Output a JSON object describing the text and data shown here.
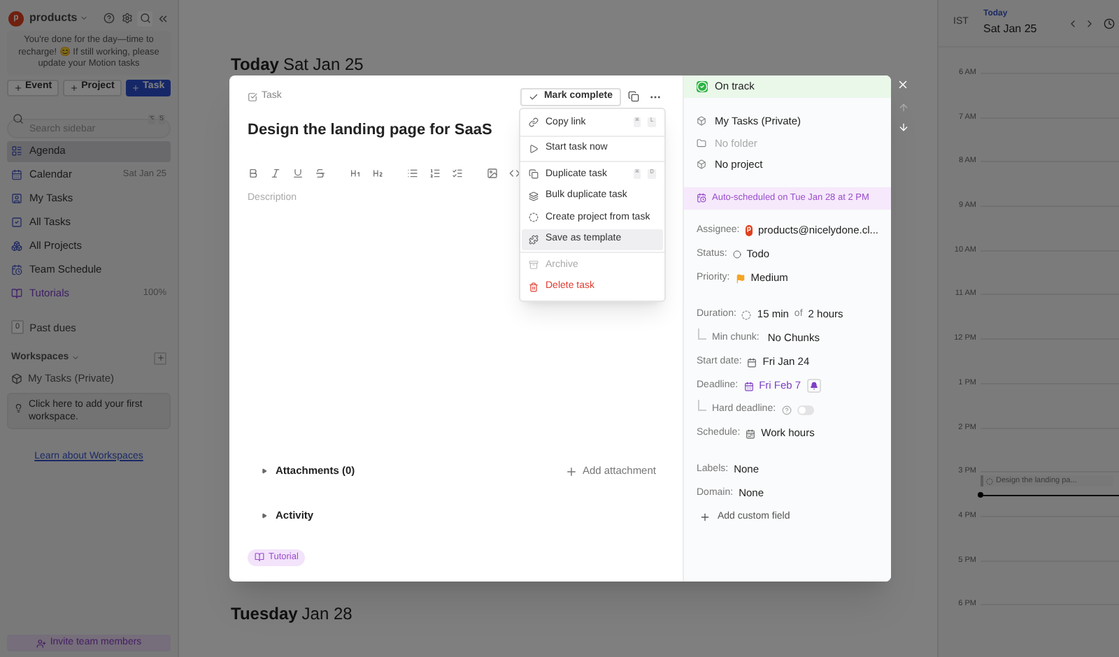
{
  "sidebar": {
    "workspace": "products",
    "avatar": "p",
    "notice": "You're done for the day—time to recharge! 😊 If still working, please update your Motion tasks",
    "buttons": [
      {
        "label": "Event",
        "kind": "secondary"
      },
      {
        "label": "Project",
        "kind": "secondary"
      },
      {
        "label": "Task",
        "kind": "primary"
      }
    ],
    "search": {
      "placeholder": "Search sidebar",
      "shortcut": [
        "⌥",
        "S"
      ]
    },
    "nav": [
      {
        "label": "Agenda",
        "selected": true,
        "kind": "view"
      },
      {
        "label": "Calendar",
        "selected": false,
        "kind": "view",
        "meta": "Sat Jan 25"
      },
      {
        "label": "My Tasks",
        "selected": false,
        "kind": "view"
      },
      {
        "label": "All Tasks",
        "selected": false,
        "kind": "view"
      },
      {
        "label": "All Projects",
        "selected": false,
        "kind": "view"
      },
      {
        "label": "Team Schedule",
        "selected": false,
        "kind": "view"
      },
      {
        "label": "Tutorials",
        "selected": false,
        "kind": "tutorial",
        "meta": "100%"
      }
    ],
    "past_dues": {
      "count": "0",
      "label": "Past dues"
    },
    "workspaces": {
      "title": "Workspaces",
      "items": [
        {
          "label": "My Tasks (Private)"
        }
      ],
      "hint": "Click here to add your first workspace.",
      "link": "Learn about Workspaces"
    },
    "invite": "Invite team members"
  },
  "agenda": {
    "sections": [
      {
        "day": "Today",
        "date": "Sat Jan 25"
      },
      {
        "day": "Tuesday",
        "date": "Jan 28"
      }
    ]
  },
  "calendar": {
    "today": "Today",
    "date": "Sat Jan 25",
    "timezone": "IST",
    "hours": [
      {
        "label": "6 AM"
      },
      {
        "label": "7 AM"
      },
      {
        "label": "8 AM"
      },
      {
        "label": "9 AM"
      },
      {
        "label": "10 AM"
      },
      {
        "label": "11 AM"
      },
      {
        "label": "12 PM"
      },
      {
        "label": "1 PM"
      },
      {
        "label": "2 PM"
      },
      {
        "label": "3 PM",
        "event": "Design the landing pa...",
        "now": true
      },
      {
        "label": "4 PM"
      },
      {
        "label": "5 PM"
      },
      {
        "label": "6 PM"
      }
    ]
  },
  "task": {
    "type": "Task",
    "title": "Design the landing page for SaaS",
    "mark_complete": "Mark complete",
    "description": {
      "placeholder": "Description"
    },
    "sections": [
      {
        "label": "Attachments (0)",
        "expanded": false,
        "action": "Add attachment"
      },
      {
        "label": "Activity",
        "expanded": false
      }
    ],
    "tag": "Tutorial",
    "menu_groups": [
      {
        "items": [
          {
            "label": "Copy link",
            "shortcut": [
              "⌘",
              "L"
            ],
            "selected": false,
            "disabled": false,
            "kind": "normal"
          }
        ]
      },
      {
        "items": [
          {
            "label": "Start task now",
            "selected": false,
            "disabled": false,
            "kind": "normal"
          }
        ]
      },
      {
        "items": [
          {
            "label": "Duplicate task",
            "shortcut": [
              "⌘",
              "D"
            ],
            "selected": false,
            "disabled": false,
            "kind": "normal"
          },
          {
            "label": "Bulk duplicate task",
            "selected": false,
            "disabled": false,
            "kind": "normal"
          },
          {
            "label": "Create project from task",
            "selected": false,
            "disabled": false,
            "kind": "normal"
          },
          {
            "label": "Save as template",
            "selected": true,
            "disabled": false,
            "kind": "normal"
          }
        ]
      },
      {
        "items": [
          {
            "label": "Archive",
            "selected": false,
            "disabled": true,
            "kind": "normal"
          },
          {
            "label": "Delete task",
            "selected": false,
            "disabled": false,
            "kind": "danger"
          }
        ]
      }
    ]
  },
  "details": {
    "status": "On track",
    "location": [
      {
        "label": "My Tasks (Private)",
        "disabled": false
      },
      {
        "label": "No folder",
        "disabled": true
      },
      {
        "label": "No project",
        "disabled": false
      }
    ],
    "auto_scheduled": "Auto-scheduled on Tue Jan 28 at 2 PM",
    "assignee": {
      "label": "Assignee:",
      "avatar": "p",
      "value": "products@nicelydone.cl..."
    },
    "status_field": {
      "label": "Status:",
      "value": "Todo"
    },
    "priority": {
      "label": "Priority:",
      "value": "Medium"
    },
    "duration": {
      "label": "Duration:",
      "value": "15 min",
      "joiner": "of",
      "total": "2 hours"
    },
    "min_chunk": {
      "label": "Min chunk:",
      "value": "No Chunks"
    },
    "start_date": {
      "label": "Start date:",
      "value": "Fri Jan 24"
    },
    "deadline": {
      "label": "Deadline:",
      "value": "Fri Feb 7"
    },
    "hard_deadline": {
      "label": "Hard deadline:",
      "on": false
    },
    "schedule": {
      "label": "Schedule:",
      "value": "Work hours"
    },
    "labels": {
      "label": "Labels:",
      "value": "None"
    },
    "domain": {
      "label": "Domain:",
      "value": "None"
    },
    "add_field": "Add custom field"
  }
}
